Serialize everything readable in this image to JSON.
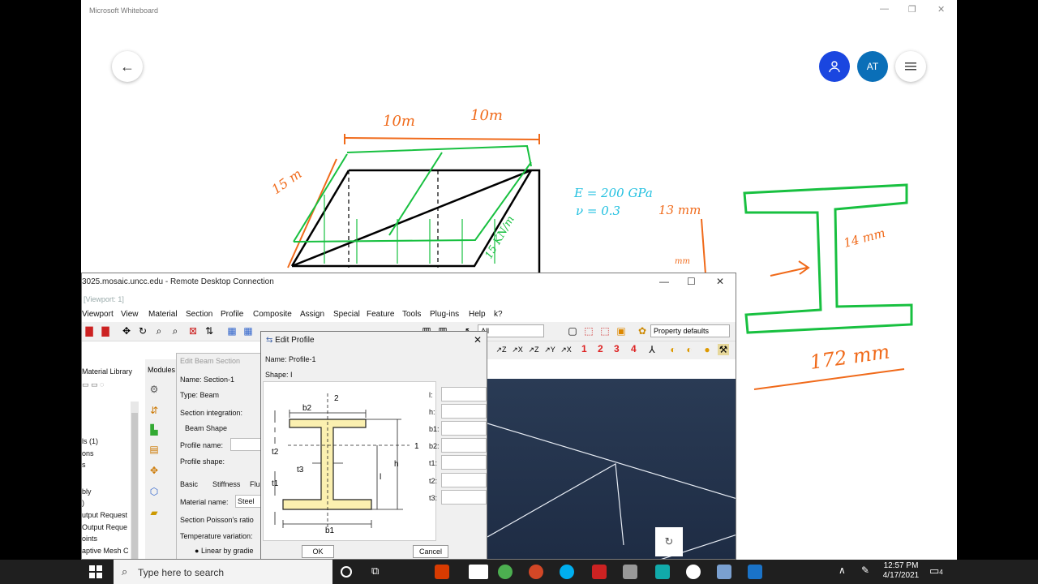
{
  "whiteboard": {
    "title": "Microsoft Whiteboard",
    "window_controls": [
      "—",
      "❐",
      "✕"
    ],
    "avatar_initials": "AT",
    "handwriting": {
      "dim_a": "10m",
      "dim_b": "10m",
      "dim_c": "15 m",
      "load": "15 KN/m",
      "modulus": "E = 200 GPa",
      "poisson": "ν = 0.3",
      "flange_t": "13 mm",
      "web_t": "14 mm",
      "depth": "172 mm",
      "small_mm": "mm"
    }
  },
  "rdc": {
    "title": "3025.mosaic.uncc.edu - Remote Desktop Connection",
    "viewport_label": "[Viewport: 1]",
    "menu": [
      "Viewport",
      "View",
      "Material",
      "Section",
      "Profile",
      "Composite",
      "Assign",
      "Special",
      "Feature",
      "Tools",
      "Plug-ins",
      "Help",
      "k?"
    ],
    "combo_all": "All",
    "property_defaults": "Property defaults",
    "numbers": [
      "1",
      "2",
      "3",
      "4"
    ],
    "left_panel": {
      "material_library": "Material Library",
      "items": [
        "ls (1)",
        "ons",
        "s",
        "bly",
        ")",
        "utput Request",
        "Output Reque",
        "oints",
        "aptive Mesh C"
      ]
    },
    "modules_label": "Modules"
  },
  "beam_section": {
    "title": "Edit Beam Section",
    "name_label": "Name:",
    "name_value": "Section-1",
    "type_label": "Type:",
    "type_value": "Beam",
    "integration_label": "Section integration:",
    "beam_shape": "Beam Shape",
    "profile_name": "Profile name:",
    "profile_shape": "Profile shape:",
    "tabs": [
      "Basic",
      "Stiffness",
      "Flu"
    ],
    "material_name_label": "Material name:",
    "material_name_value": "Steel",
    "poisson_label": "Section Poisson's ratio",
    "temp_label": "Temperature variation:",
    "linear_label": "Linear by gradie"
  },
  "edit_profile": {
    "title": "Edit Profile",
    "close": "✕",
    "name_label": "Name:",
    "name_value": "Profile-1",
    "shape_label": "Shape:",
    "shape_value": "I",
    "fields": [
      "l:",
      "h:",
      "b1:",
      "b2:",
      "t1:",
      "t2:",
      "t3:"
    ],
    "figure_labels": {
      "b2": "b2",
      "axis2": "2",
      "axis1": "1",
      "t2": "t2",
      "t3": "t3",
      "t1": "t1",
      "l": "l",
      "h": "h",
      "b1": "b1"
    },
    "ok": "OK",
    "cancel": "Cancel"
  },
  "taskbar": {
    "search_placeholder": "Type here to search",
    "time": "12:57 PM",
    "date": "4/17/2021",
    "notification_count": "4"
  }
}
